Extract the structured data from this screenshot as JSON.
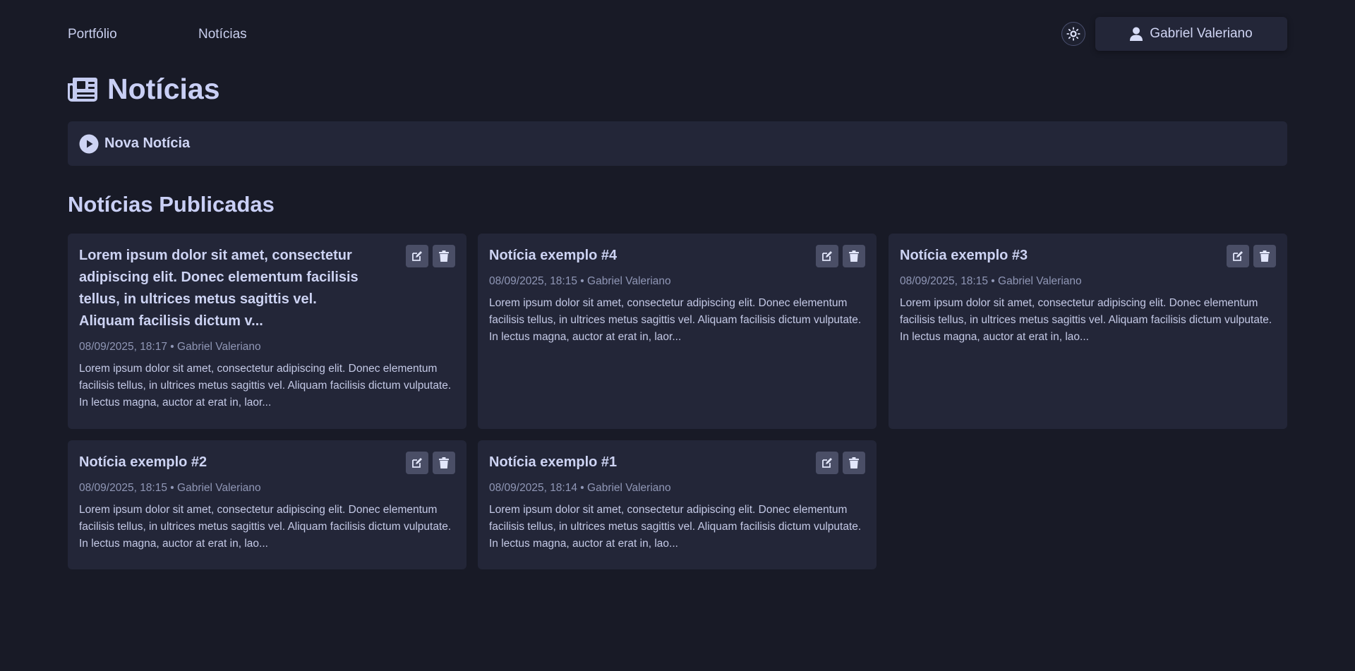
{
  "nav": {
    "links": [
      "Portfólio",
      "Notícias"
    ],
    "user_name": "Gabriel Valeriano"
  },
  "page": {
    "title": "Notícias",
    "new_button_label": "Nova Notícia",
    "section_title": "Notícias Publicadas"
  },
  "cards": [
    {
      "title": "Lorem ipsum dolor sit amet, consectetur adipiscing elit. Donec elementum facilisis tellus, in ultrices metus sagittis vel. Aliquam facilisis dictum v...",
      "meta": "08/09/2025, 18:17 • Gabriel Valeriano",
      "body": "Lorem ipsum dolor sit amet, consectetur adipiscing elit. Donec elementum facilisis tellus, in ultrices metus sagittis vel. Aliquam facilisis dictum vulputate. In lectus magna, auctor at erat in, laor..."
    },
    {
      "title": "Notícia exemplo #4",
      "meta": "08/09/2025, 18:15 • Gabriel Valeriano",
      "body": "Lorem ipsum dolor sit amet, consectetur adipiscing elit. Donec elementum facilisis tellus, in ultrices metus sagittis vel. Aliquam facilisis dictum vulputate. In lectus magna, auctor at erat in, laor..."
    },
    {
      "title": "Notícia exemplo #3",
      "meta": "08/09/2025, 18:15 • Gabriel Valeriano",
      "body": "Lorem ipsum dolor sit amet, consectetur adipiscing elit. Donec elementum facilisis tellus, in ultrices metus sagittis vel. Aliquam facilisis dictum vulputate. In lectus magna, auctor at erat in, lao..."
    },
    {
      "title": "Notícia exemplo #2",
      "meta": "08/09/2025, 18:15 • Gabriel Valeriano",
      "body": "Lorem ipsum dolor sit amet, consectetur adipiscing elit. Donec elementum facilisis tellus, in ultrices metus sagittis vel. Aliquam facilisis dictum vulputate. In lectus magna, auctor at erat in, lao..."
    },
    {
      "title": "Notícia exemplo #1",
      "meta": "08/09/2025, 18:14 • Gabriel Valeriano",
      "body": "Lorem ipsum dolor sit amet, consectetur adipiscing elit. Donec elementum facilisis tellus, in ultrices metus sagittis vel. Aliquam facilisis dictum vulputate. In lectus magna, auctor at erat in, lao..."
    }
  ],
  "icons": {
    "theme": "sun-icon",
    "user": "user-icon",
    "page": "newspaper-icon",
    "new": "play-circle-icon",
    "edit": "edit-icon",
    "delete": "trash-icon"
  },
  "colors": {
    "background": "#181a26",
    "surface": "#232638",
    "text": "#c7cdf0",
    "button": "#4a4e66"
  }
}
